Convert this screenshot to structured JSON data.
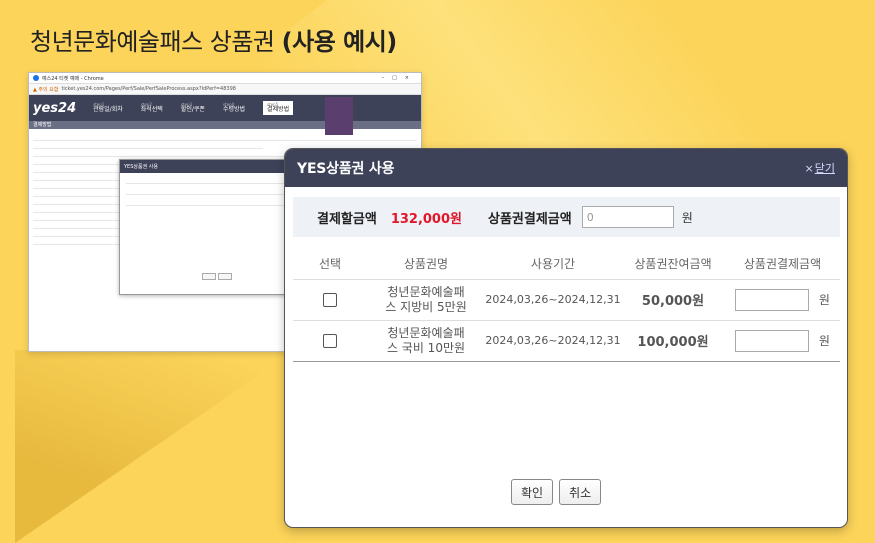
{
  "page_title": {
    "normal": "청년문화예술패스 상품권",
    "bold": "(사용 예시)"
  },
  "background_window": {
    "title": "예스24 티켓 예매 - Chrome",
    "url_warning": "▲ 주의 요함",
    "url": "ticket.yes24.com/Pages/Perf/Sale/PerfSaleProcess.aspx?IdPerf=48398",
    "logo": "yes24",
    "steps": [
      {
        "num": "step1",
        "label": "관람일/회차"
      },
      {
        "num": "step2",
        "label": "좌석선택"
      },
      {
        "num": "step3",
        "label": "할인/쿠폰"
      },
      {
        "num": "step4",
        "label": "수령방법"
      },
      {
        "num": "step5",
        "label": "결제방법"
      }
    ],
    "section_label": "결제방법",
    "popup_title": "YES상품권 사용"
  },
  "dialog": {
    "title": "YES상품권 사용",
    "close_symbol": "×",
    "close_label": "닫기",
    "summary": {
      "payment_amount_label": "결제할금액",
      "payment_amount_value": "132,000원",
      "voucher_payment_label": "상품권결제금액",
      "voucher_payment_value": "0",
      "currency": "원"
    },
    "columns": [
      "선택",
      "상품권명",
      "사용기간",
      "상품권잔여금액",
      "상품권결제금액"
    ],
    "rows": [
      {
        "name_line1": "청년문화예술패",
        "name_line2": "스 지방비 5만원",
        "period": "2024,03,26~2024,12,31",
        "balance": "50,000원",
        "unit": "원"
      },
      {
        "name_line1": "청년문화예술패",
        "name_line2": "스 국비 10만원",
        "period": "2024,03,26~2024,12,31",
        "balance": "100,000원",
        "unit": "원"
      }
    ],
    "confirm_label": "확인",
    "cancel_label": "취소"
  }
}
